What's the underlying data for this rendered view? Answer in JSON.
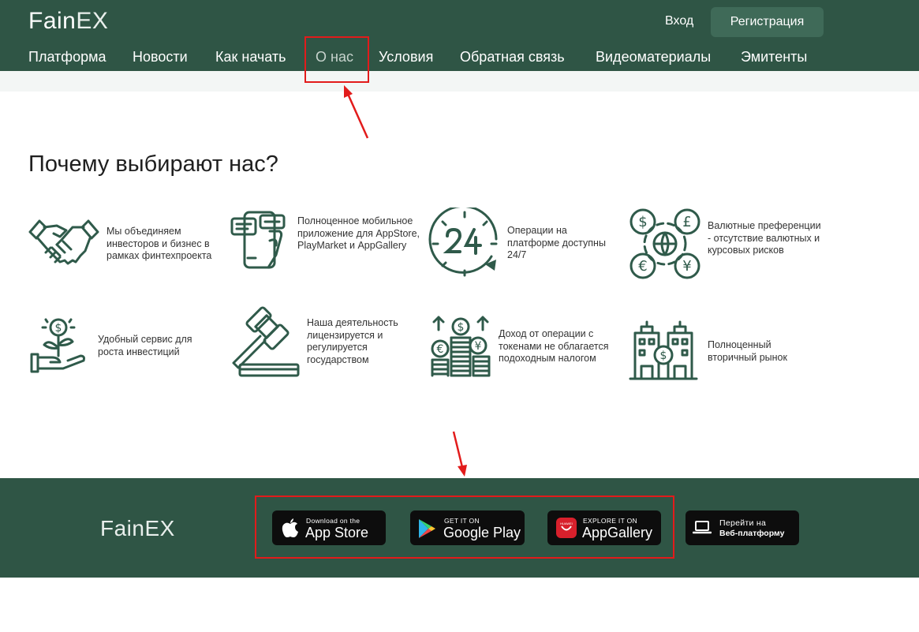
{
  "header": {
    "logo": {
      "part1": "Fain",
      "part2": "EX"
    },
    "login": "Вход",
    "register": "Регистрация",
    "nav": [
      {
        "label": "Платформа"
      },
      {
        "label": "Новости"
      },
      {
        "label": "Как начать"
      },
      {
        "label": "О нас",
        "active": true
      },
      {
        "label": "Условия"
      },
      {
        "label": "Обратная связь"
      },
      {
        "label": "Видеоматериалы"
      },
      {
        "label": "Эмитенты"
      }
    ]
  },
  "section": {
    "title": "Почему выбирают нас?",
    "features": [
      {
        "icon": "handshake-icon",
        "text": "Мы объединяем инвесторов и бизнес в рамках финтехпроекта"
      },
      {
        "icon": "mobile-app-icon",
        "text": "Полноценное мобильное приложение для AppStore, PlayMarket и AppGallery"
      },
      {
        "icon": "clock-24-icon",
        "text": "Операции на платформе доступны 24/7"
      },
      {
        "icon": "currency-exchange-icon",
        "text": "Валютные преференции - отсутствие валютных и курсовых рисков"
      },
      {
        "icon": "money-plant-icon",
        "text": "Удобный сервис для роста инвестиций"
      },
      {
        "icon": "gavel-icon",
        "text": "Наша деятельность лицензируется и регулируется государством"
      },
      {
        "icon": "coins-stack-icon",
        "text": "Доход от операции с токенами не облагается подоходным налогом"
      },
      {
        "icon": "buildings-icon",
        "text": "Полноценный вторичный рынок"
      }
    ]
  },
  "footer": {
    "logo": {
      "part1": "Fain",
      "part2": "EX"
    },
    "app_store": {
      "small": "Download on the",
      "big": "App Store"
    },
    "google_play": {
      "small": "GET IT ON",
      "big": "Google Play"
    },
    "app_gallery": {
      "small": "EXPLORE IT ON",
      "big": "AppGallery",
      "badge": "HUAWEI"
    },
    "web": {
      "line1": "Перейти на",
      "line2": "Веб-платформу"
    }
  },
  "colors": {
    "brand_green": "#2f5545",
    "icon_green": "#2f5a4a",
    "highlight_red": "#e21b1b"
  }
}
